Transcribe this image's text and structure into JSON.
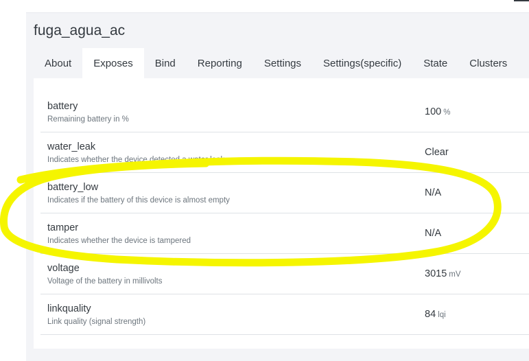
{
  "device": {
    "title": "fuga_agua_ac"
  },
  "tabs": [
    {
      "label": "About",
      "active": false
    },
    {
      "label": "Exposes",
      "active": true
    },
    {
      "label": "Bind",
      "active": false
    },
    {
      "label": "Reporting",
      "active": false
    },
    {
      "label": "Settings",
      "active": false
    },
    {
      "label": "Settings(specific)",
      "active": false
    },
    {
      "label": "State",
      "active": false
    },
    {
      "label": "Clusters",
      "active": false
    }
  ],
  "exposes": [
    {
      "name": "battery",
      "description": "Remaining battery in %",
      "value": "100",
      "unit": "%"
    },
    {
      "name": "water_leak",
      "description": "Indicates whether the device detected a water leak",
      "value": "Clear",
      "unit": ""
    },
    {
      "name": "battery_low",
      "description": "Indicates if the battery of this device is almost empty",
      "value": "N/A",
      "unit": ""
    },
    {
      "name": "tamper",
      "description": "Indicates whether the device is tampered",
      "value": "N/A",
      "unit": ""
    },
    {
      "name": "voltage",
      "description": "Voltage of the battery in millivolts",
      "value": "3015",
      "unit": "mV"
    },
    {
      "name": "linkquality",
      "description": "Link quality (signal strength)",
      "value": "84",
      "unit": "lqi"
    }
  ],
  "annotation": {
    "color": "#f5f500"
  }
}
